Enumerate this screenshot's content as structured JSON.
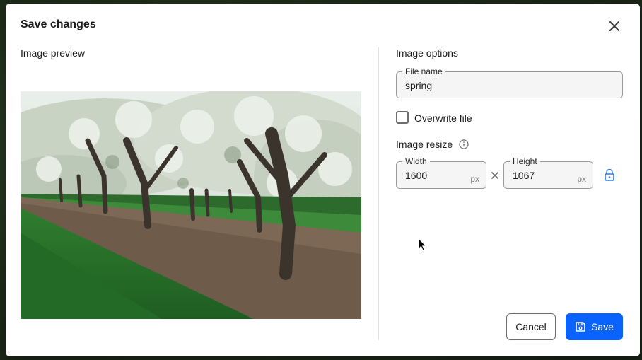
{
  "dialog": {
    "title": "Save changes",
    "close_icon": "close-icon"
  },
  "preview": {
    "label": "Image preview",
    "image_icon": "cherry-orchard-photo"
  },
  "options": {
    "label": "Image options",
    "file_name": {
      "label": "File name",
      "value": "spring"
    },
    "overwrite": {
      "label": "Overwrite file",
      "checked": false
    },
    "resize": {
      "label": "Image resize",
      "info_icon": "info-icon",
      "width": {
        "label": "Width",
        "value": "1600",
        "unit": "px"
      },
      "height": {
        "label": "Height",
        "value": "1067",
        "unit": "px"
      },
      "lock_icon": "lock-icon"
    }
  },
  "actions": {
    "cancel_label": "Cancel",
    "save_label": "Save",
    "save_icon": "floppy-disk-icon"
  },
  "colors": {
    "accent": "#0a63ff",
    "lock_icon": "#2f7bf5"
  }
}
